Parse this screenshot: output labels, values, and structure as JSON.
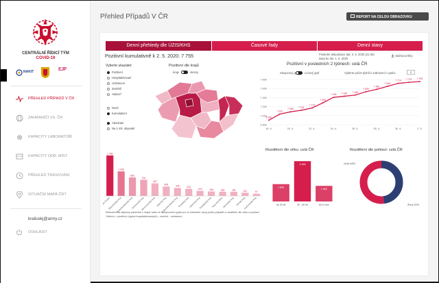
{
  "sidebar": {
    "brand_line1": "CENTRÁLNÍ ŘÍDICÍ TÝM",
    "brand_line2": "COVID-19",
    "partner_nakit": "NAKIT",
    "partner_ejp": "EJP",
    "nav": [
      {
        "label": "PŘEHLED PŘÍPADŮ V ČR",
        "active": true
      },
      {
        "label": "ZAHRANIČÍ VS. ČR"
      },
      {
        "label": "KAPACITY LABORATOŘÍ"
      },
      {
        "label": "KAPACITY ODB. MÍST"
      },
      {
        "label": "PŘEHLED TRASOVÁNÍ"
      },
      {
        "label": "SITUAČNÍ MAPA ČRT"
      }
    ],
    "user_email": "kralicekj@army.cz",
    "logout_label": "ODHLÁSIT"
  },
  "header": {
    "title": "Přehled Případů V ČR",
    "fullscreen_label": "REPORT NA CELOU OBRAZOVKU"
  },
  "tabs": [
    {
      "label": "Denní přehledy dle ÚZIS/KHS",
      "active": true
    },
    {
      "label": "Časové řady"
    },
    {
      "label": "Denní stavy"
    }
  ],
  "summary": {
    "cumulative": "Pozitivní kumulativně k 2. 5. 2020: 7 755",
    "updated_line1": "Poslední aktualizace dat: 2. 5. 2020 (21:40)",
    "updated_line2": "Data ke dni: 1. 5. 2020",
    "download_label": "Stáhnout filtry"
  },
  "indicator": {
    "label": "Vyberte ukazatel:",
    "options": [
      "Pozitivní",
      "Hospitalizovaní",
      "Uzdravení",
      "Zemřelí",
      "Aktivní*"
    ],
    "selected": 0,
    "mode_options": [
      "Nové",
      "Kumulativní"
    ],
    "mode_selected": 1,
    "scale_options": [
      "Absolutní",
      "Na 1 mil. obyvatel"
    ],
    "scale_selected": 0
  },
  "map": {
    "title": "Pozitivní dle krajů",
    "toggle_left": "kraje",
    "toggle_right": "okresy"
  },
  "line_panel": {
    "title": "Pozitivní v posledních 2 týdnech: celá ČR",
    "toggle_left": "Sloupcový graf",
    "toggle_right": "Liniový graf",
    "days_label": "Vyberte počet týdnů k zobrazení v grafu:",
    "days_value": "2"
  },
  "colors": {
    "accent": "#d51e4c",
    "accent_dark": "#a8123a",
    "donut_light": "#2d3e73"
  },
  "chart_data": [
    {
      "type": "line",
      "title": "Pozitivní v posledních 2 týdnech: celá ČR",
      "x": [
        "18. 4.",
        "19. 4.",
        "20. 4.",
        "21. 4.",
        "22. 4.",
        "23. 4.",
        "24. 4.",
        "25. 4.",
        "26. 4.",
        "27. 4.",
        "28. 4.",
        "29. 4.",
        "30. 4.",
        "1. 5.",
        "2. 5."
      ],
      "x_ticks": [
        "18. 4.",
        "20. 4.",
        "22. 4.",
        "24. 4.",
        "26. 4.",
        "28. 4.",
        "30. 4.",
        "2. 5."
      ],
      "values": [
        6900,
        7033,
        7085,
        7119,
        7170,
        7283,
        7405,
        7430,
        7455,
        7529,
        7582,
        7648,
        7714,
        7737,
        7755
      ],
      "labels": [
        "6 900",
        "7 033",
        "7 085",
        "7 119",
        "7 170",
        "7 283",
        "7 405",
        "7 430",
        "7 455",
        "7 529",
        "7 582",
        "7 648",
        "7 714",
        "7 737",
        "7 755"
      ],
      "y_ticks": [
        "6 800",
        "7 000",
        "7 200",
        "7 400",
        "7 600",
        "7 800"
      ],
      "ylim": [
        6800,
        7800
      ]
    },
    {
      "type": "bar",
      "title": "",
      "categories": [
        "Hlavní město Praha",
        "Středočeský kraj",
        "Moravskoslezský kraj",
        "Olomoucký kraj",
        "Jihomoravský kraj",
        "Ústecký kraj",
        "Královéhradecký kraj",
        "Plzeňský kraj",
        "Liberecký kraj",
        "Pardubický kraj",
        "Kraj Vysočina",
        "Jihočeský kraj",
        "Zlínský kraj",
        "Karlovarský kraj"
      ],
      "values": [
        1756,
        1066,
        805,
        702,
        547,
        409,
        349,
        313,
        223,
        196,
        183,
        181,
        141,
        97
      ],
      "labels": [
        "1 756",
        "1 066",
        "805",
        "702",
        "547",
        "409",
        "349",
        "313",
        "223",
        "196",
        "183",
        "181",
        "141",
        "97"
      ],
      "ylim": [
        0,
        1900
      ]
    },
    {
      "type": "bar",
      "title": "Rozdělení dle věku: celá ČR",
      "categories": [
        "do 30 let",
        "30 - 60 let",
        "60 a více"
      ],
      "values": [
        1834,
        4269,
        1652
      ],
      "labels": [
        "1 834",
        "4 269",
        "1 652"
      ],
      "ylim": [
        0,
        4500
      ]
    },
    {
      "type": "pie",
      "title": "Rozdělení dle pohlaví: celá ČR",
      "slices": [
        {
          "name": "Muži",
          "value": 48
        },
        {
          "name": "Ženy",
          "value": 52
        }
      ],
      "labels": [
        "Muži 48%",
        "Ženy 52%"
      ]
    }
  ],
  "footnotes": {
    "line1": "Kliknutím na zájmový parametr v mapě nebo ve sloupcovém grafu pro ni zobrazíte vývoj počtu případů a rozdělení dle věku a pohlaví",
    "line2": "*Aktivní = pozitivní (vyjma hospitalizovaných) - zemřelí - uzdravení"
  }
}
